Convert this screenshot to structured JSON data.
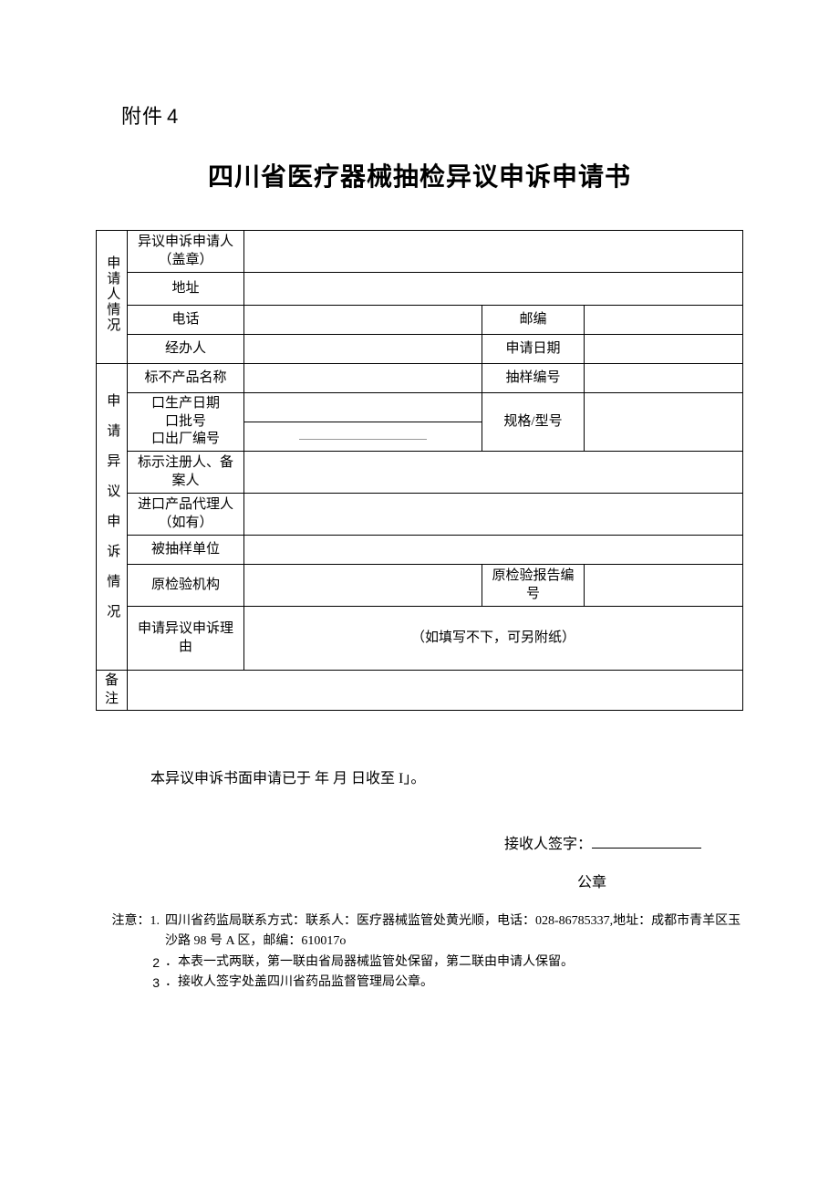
{
  "attach_prefix": "附件",
  "attach_num": "4",
  "title": "四川省医疗器械抽检异议申诉申请书",
  "sec1": {
    "header": "申请人情况",
    "r1": "异议申诉申请人（盖章）",
    "r2": "地址",
    "r3": "电话",
    "r3b": "邮编",
    "r4": "经办人",
    "r4b": "申请日期"
  },
  "sec2": {
    "header": "申请异议申诉情况",
    "r1": "标不产品名称",
    "r1b": "抽样编号",
    "r2_line1": "口生产日期",
    "r2_line2": "口批号",
    "r2_line3": "口出厂编号",
    "r2b": "规格/型号",
    "r3": "标示注册人、备案人",
    "r4": "进口产品代理人（如有）",
    "r5": "被抽样单位",
    "r6": "原检验机构",
    "r6b": "原检验报告编号",
    "r7": "申请异议申诉理由",
    "r7_hint": "（如填写不下，可另附纸）"
  },
  "sec3": "备注",
  "receipt_line": "本异议申诉书面申请已于 年 月 日收至 I」。",
  "sig_label": "接收人签字：",
  "stamp_label": "公章",
  "notes": {
    "lead": "注意：",
    "n1_lead": "1.",
    "n1": "四川省药监局联系方式：联系人：医疗器械监管处黄光顺，电话：028-86785337,地址：成都市青羊区玉沙路 98 号 A 区，邮编：610017o",
    "n2_lead": "2",
    "n2": "．本表一式两联，第一联由省局器械监管处保留，第二联由申请人保留。",
    "n3_lead": "3",
    "n3": "．接收人签字处盖四川省药品监督管理局公章。"
  }
}
